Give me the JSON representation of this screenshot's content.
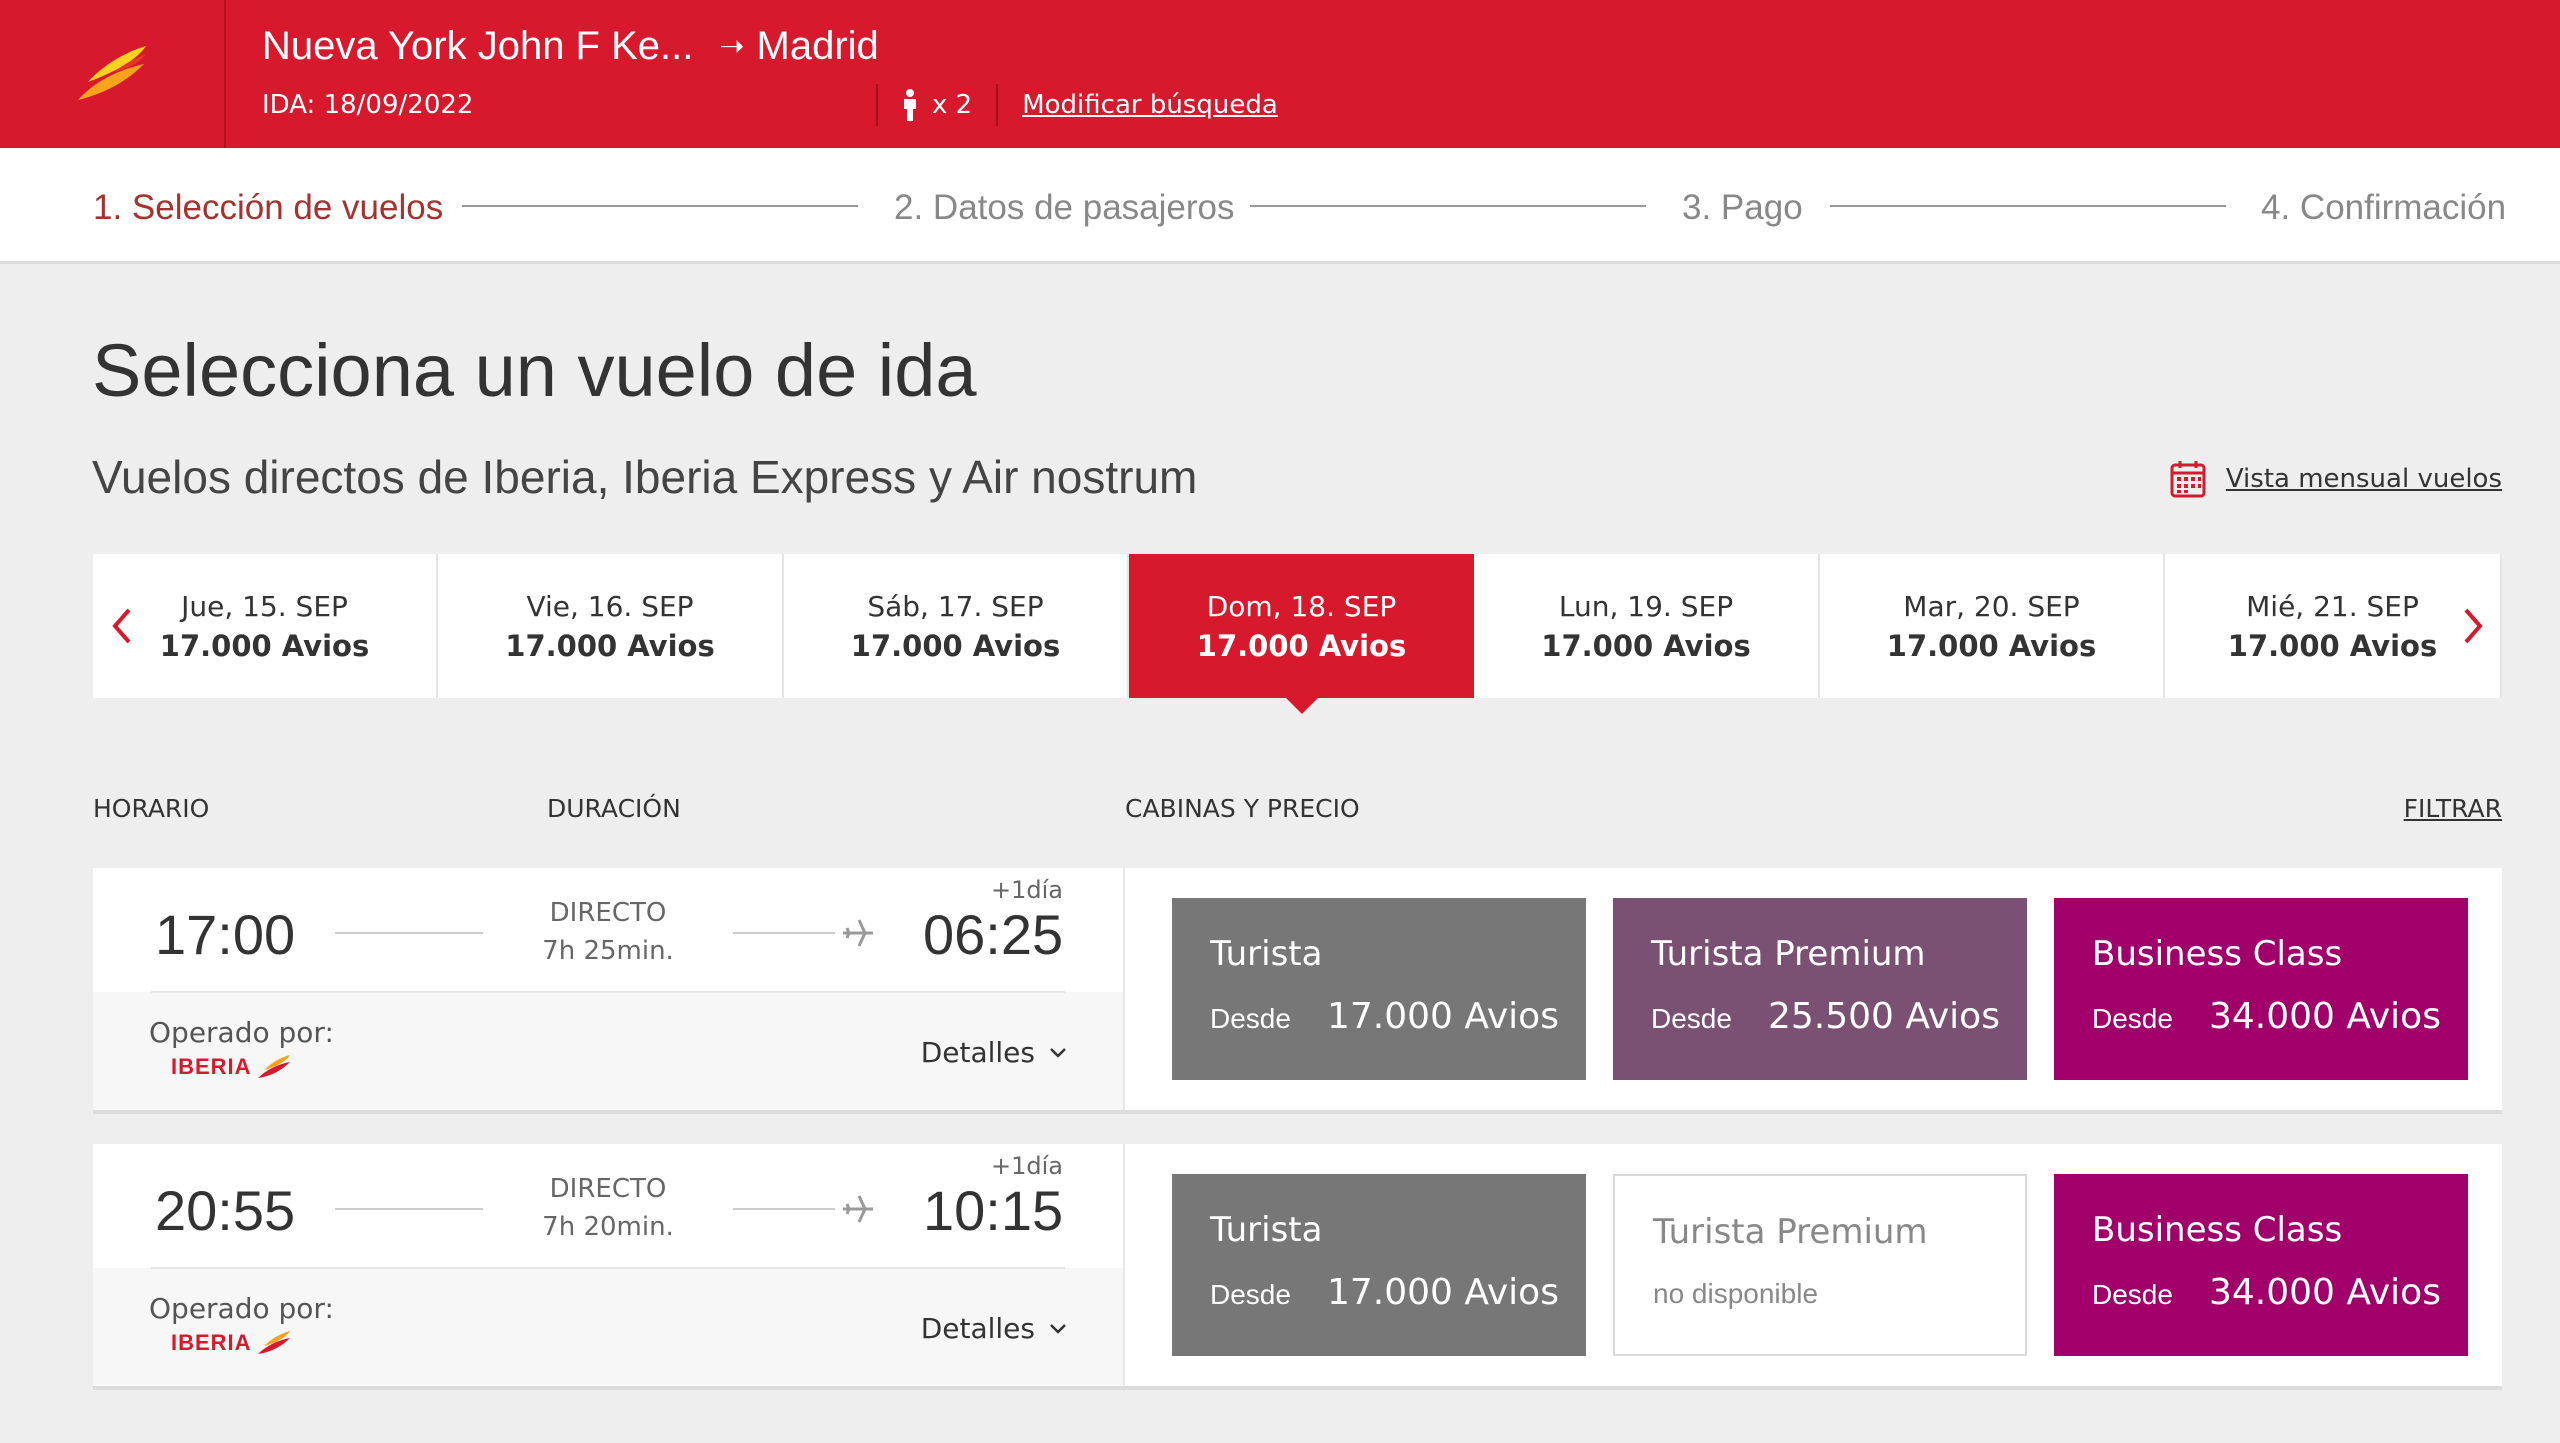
{
  "header": {
    "origin": "Nueva York John F Ke...",
    "destination": "Madrid",
    "outbound_date": "IDA: 18/09/2022",
    "passengers": "x 2",
    "modify_label": "Modificar búsqueda",
    "brand_color": "#d7192d"
  },
  "steps": [
    {
      "label": "1. Selección de vuelos",
      "active": true
    },
    {
      "label": "2. Datos de pasajeros",
      "active": false
    },
    {
      "label": "3. Pago",
      "active": false
    },
    {
      "label": "4. Confirmación",
      "active": false
    }
  ],
  "page": {
    "title": "Selecciona un vuelo de ida",
    "subtitle": "Vuelos directos de Iberia, Iberia Express y Air nostrum",
    "monthly_view_label": "Vista mensual vuelos"
  },
  "dates": [
    {
      "label": "Jue, 15. SEP",
      "price": "17.000 Avios",
      "selected": false
    },
    {
      "label": "Vie, 16. SEP",
      "price": "17.000 Avios",
      "selected": false
    },
    {
      "label": "Sáb, 17. SEP",
      "price": "17.000 Avios",
      "selected": false
    },
    {
      "label": "Dom, 18. SEP",
      "price": "17.000 Avios",
      "selected": true
    },
    {
      "label": "Lun, 19. SEP",
      "price": "17.000 Avios",
      "selected": false
    },
    {
      "label": "Mar, 20. SEP",
      "price": "17.000 Avios",
      "selected": false
    },
    {
      "label": "Mié, 21. SEP",
      "price": "17.000 Avios",
      "selected": false
    }
  ],
  "columns": {
    "schedule": "HORARIO",
    "duration": "DURACIÓN",
    "cabins": "CABINAS Y PRECIO",
    "filter": "FILTRAR"
  },
  "flights": [
    {
      "departure": "17:00",
      "arrival": "06:25",
      "next_day": "+1día",
      "type": "DIRECTO",
      "duration": "7h 25min.",
      "operated_by_label": "Operado por:",
      "operator": "IBERIA",
      "details_label": "Detalles",
      "cabins": {
        "turista": {
          "name": "Turista",
          "from": "Desde",
          "price": "17.000 Avios"
        },
        "premium": {
          "name": "Turista Premium",
          "from": "Desde",
          "price": "25.500 Avios"
        },
        "business": {
          "name": "Business Class",
          "from": "Desde",
          "price": "34.000 Avios"
        }
      }
    },
    {
      "departure": "20:55",
      "arrival": "10:15",
      "next_day": "+1día",
      "type": "DIRECTO",
      "duration": "7h 20min.",
      "operated_by_label": "Operado por:",
      "operator": "IBERIA",
      "details_label": "Detalles",
      "cabins": {
        "turista": {
          "name": "Turista",
          "from": "Desde",
          "price": "17.000 Avios"
        },
        "premium": {
          "name": "Turista Premium",
          "unavailable": "no disponible"
        },
        "business": {
          "name": "Business Class",
          "from": "Desde",
          "price": "34.000 Avios"
        }
      }
    }
  ],
  "colors": {
    "turista": "#777777",
    "premium": "#7a5172",
    "business": "#a1006b",
    "active_step": "#a6322f"
  }
}
